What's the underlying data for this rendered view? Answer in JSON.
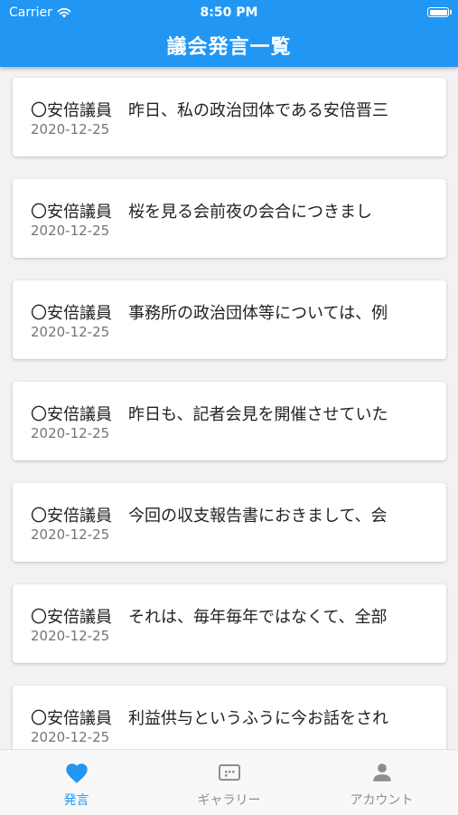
{
  "status_bar": {
    "carrier": "Carrier",
    "time": "8:50 PM"
  },
  "app_bar": {
    "title": "議会発言一覧"
  },
  "speeches": [
    {
      "text": "〇安倍議員　昨日、私の政治団体である安倍晋三",
      "date": "2020-12-25"
    },
    {
      "text": "〇安倍議員　桜を見る会前夜の会合につきまし",
      "date": "2020-12-25"
    },
    {
      "text": "〇安倍議員　事務所の政治団体等については、例",
      "date": "2020-12-25"
    },
    {
      "text": "〇安倍議員　昨日も、記者会見を開催させていた",
      "date": "2020-12-25"
    },
    {
      "text": "〇安倍議員　今回の収支報告書におきまして、会",
      "date": "2020-12-25"
    },
    {
      "text": "〇安倍議員　それは、毎年毎年ではなくて、全部",
      "date": "2020-12-25"
    },
    {
      "text": "〇安倍議員　利益供与というふうに今お話をされ",
      "date": "2020-12-25"
    }
  ],
  "tabs": [
    {
      "label": "発言",
      "icon": "heart-icon",
      "active": true
    },
    {
      "label": "ギャラリー",
      "icon": "gallery-icon",
      "active": false
    },
    {
      "label": "アカウント",
      "icon": "person-icon",
      "active": false
    }
  ],
  "colors": {
    "primary": "#2196f3",
    "inactive": "#8e8e8e",
    "date": "#757575"
  }
}
